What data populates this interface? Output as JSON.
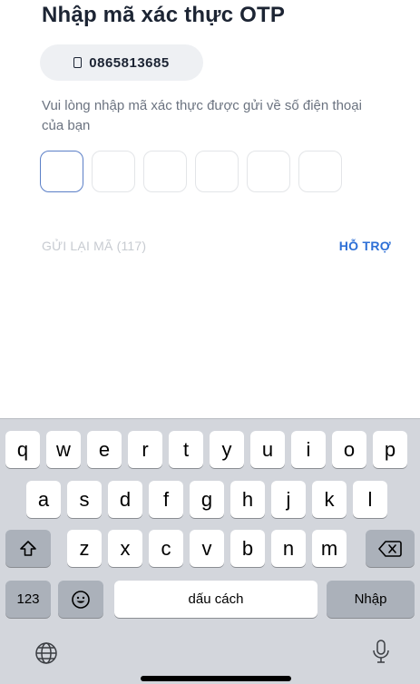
{
  "screen": {
    "title": "Nhập mã xác thực OTP",
    "phone_number": "0865813685",
    "instruction": "Vui lòng nhập mã xác thực được gửi về số điện thoại của bạn",
    "otp_length": 6,
    "resend_label": "GỬI LẠI MÃ (117)",
    "support_label": "HỖ TRỢ"
  },
  "keyboard": {
    "row1": [
      "q",
      "w",
      "e",
      "r",
      "t",
      "y",
      "u",
      "i",
      "o",
      "p"
    ],
    "row2": [
      "a",
      "s",
      "d",
      "f",
      "g",
      "h",
      "j",
      "k",
      "l"
    ],
    "row3": [
      "z",
      "x",
      "c",
      "v",
      "b",
      "n",
      "m"
    ],
    "numbers_key": "123",
    "space_label": "dấu cách",
    "return_label": "Nhập",
    "icons": {
      "shift": "shift-icon",
      "backspace": "backspace-icon",
      "emoji": "emoji-icon",
      "globe": "globe-icon",
      "mic": "microphone-icon"
    }
  },
  "colors": {
    "accent": "#2d6fd6",
    "active_box_border": "#5b7fc7",
    "muted_text": "#c7cbd1",
    "keyboard_bg": "#d3d6dc"
  }
}
